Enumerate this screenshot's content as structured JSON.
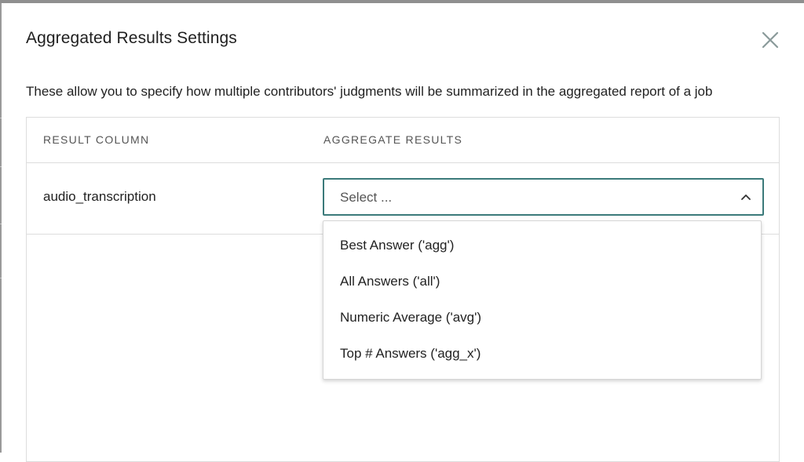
{
  "modal": {
    "title": "Aggregated Results Settings",
    "description": "These allow you to specify how multiple contributors' judgments will be summarized in the aggregated report of a job"
  },
  "table": {
    "columns": [
      "RESULT COLUMN",
      "AGGREGATE RESULTS"
    ],
    "rows": [
      {
        "result_column": "audio_transcription",
        "aggregate_value": "Select ..."
      }
    ]
  },
  "dropdown": {
    "open": true,
    "options": [
      "Best Answer ('agg')",
      "All Answers ('all')",
      "Numeric Average ('avg')",
      "Top # Answers ('agg_x')"
    ]
  },
  "icons": {
    "close": "close-icon",
    "chevron": "chevron-up-icon"
  },
  "colors": {
    "select_border": "#3b7a7a",
    "text": "#222222",
    "muted_text": "#555555",
    "divider": "#dddddd",
    "close_icon": "#8a9a9a"
  }
}
